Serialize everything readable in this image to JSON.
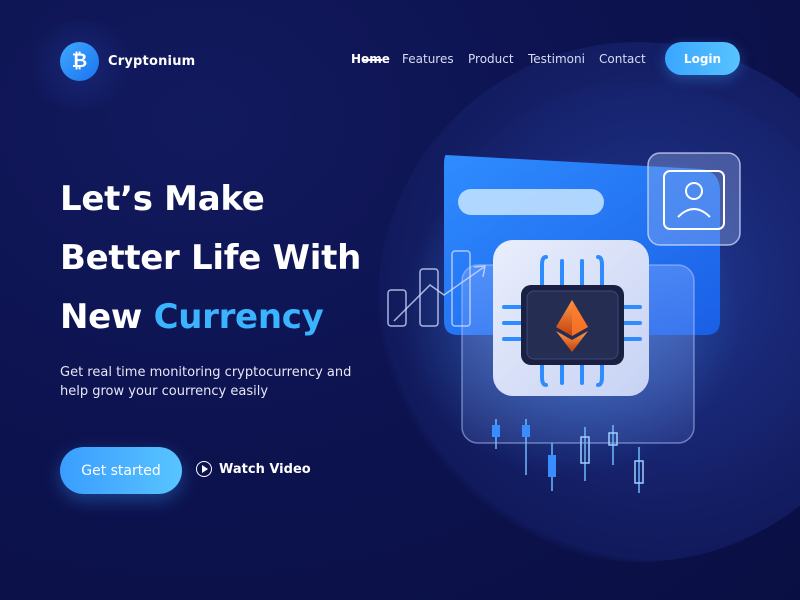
{
  "brand": {
    "logo_symbol": "₿",
    "name": "Cryptonium"
  },
  "nav": {
    "items": [
      {
        "label": "Home",
        "active": true
      },
      {
        "label": "Features",
        "active": false
      },
      {
        "label": "Product",
        "active": false
      },
      {
        "label": "Testimoni",
        "active": false
      },
      {
        "label": "Contact",
        "active": false
      }
    ],
    "login_label": "Login"
  },
  "hero": {
    "line1": "Let’s Make",
    "line2": "Better Life With",
    "line3_plain": "New ",
    "line3_accent": "Currency",
    "subtitle_line1": "Get real time monitoring cryptocurrency and",
    "subtitle_line2": "help grow your courrency easily",
    "cta_label": "Get started",
    "watch_label": "Watch Video"
  },
  "illustration": {
    "icon": "ethereum-chip-icon"
  },
  "colors": {
    "background": "#0b1046",
    "accent": "#3bb4ff",
    "button_gradient_start": "#3a9dff",
    "button_gradient_end": "#58c4ff"
  }
}
